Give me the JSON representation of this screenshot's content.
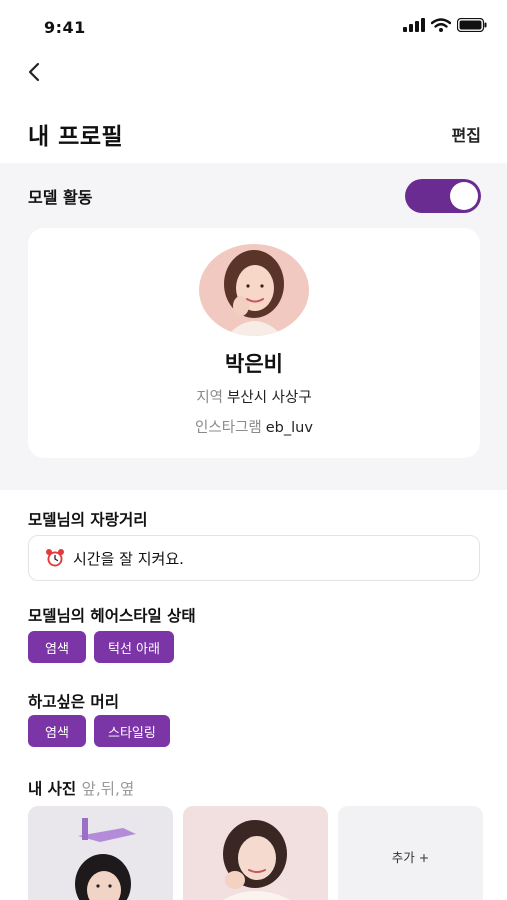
{
  "status_bar": {
    "time": "9:41"
  },
  "header": {
    "title": "내 프로필",
    "edit_label": "편집"
  },
  "model_activity": {
    "label": "모델 활동",
    "enabled": true,
    "accent": "#6b2c91"
  },
  "profile": {
    "name": "박은비",
    "region_key": "지역",
    "region_value": "부산시 사상구",
    "instagram_key": "인스타그램",
    "instagram_value": "eb_luv"
  },
  "bragging": {
    "title": "모델님의 자랑거리",
    "text": "시간을 잘 지켜요."
  },
  "hair_status": {
    "title": "모델님의 헤어스타일 상태",
    "chips": [
      "염색",
      "턱선 아래"
    ]
  },
  "desired_hair": {
    "title": "하고싶은 머리",
    "chips": [
      "염색",
      "스타일링"
    ]
  },
  "photos": {
    "title": "내 사진",
    "subtitle": "앞,뒤,옆",
    "add_label": "추가 +"
  },
  "colors": {
    "chip": "#7b35a6",
    "section_bg": "#f5f5f7"
  }
}
